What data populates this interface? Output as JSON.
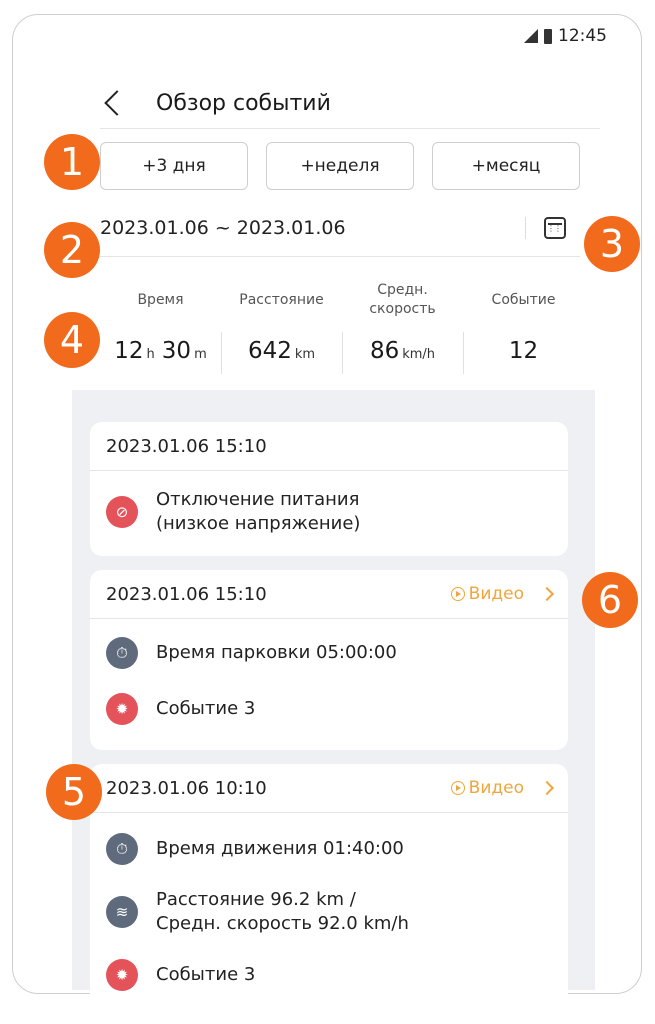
{
  "status": {
    "time": "12:45"
  },
  "header": {
    "title": "Обзор событий"
  },
  "range_buttons": [
    "+3 дня",
    "+неделя",
    "+месяц"
  ],
  "date_range": "2023.01.06 ~ 2023.01.06",
  "stats": {
    "time_label": "Время",
    "time_hours": "12",
    "time_hours_unit": "h",
    "time_minutes": "30",
    "time_minutes_unit": "m",
    "distance_label": "Расстояние",
    "distance_value": "642",
    "distance_unit": "km",
    "speed_label_1": "Средн.",
    "speed_label_2": "скорость",
    "speed_value": "86",
    "speed_unit": "km/h",
    "events_label": "Событие",
    "events_value": "12"
  },
  "cards": [
    {
      "time": "2023.01.06 15:10",
      "events": [
        {
          "icon": "power-off-icon",
          "line1": "Отключение питания",
          "line2": "(низкое напряжение)"
        }
      ]
    },
    {
      "time": "2023.01.06 15:10",
      "video_label": "Видео",
      "events": [
        {
          "icon": "stopwatch-icon",
          "line1": "Время парковки 05:00:00"
        },
        {
          "icon": "car-impact-icon",
          "line1": "Событие 3"
        }
      ]
    },
    {
      "time": "2023.01.06 10:10",
      "video_label": "Видео",
      "events": [
        {
          "icon": "stopwatch-icon",
          "line1": "Время движения 01:40:00"
        },
        {
          "icon": "route-icon",
          "line1": "Расстояние 96.2 km /",
          "line2": "Средн. скорость 92.0 km/h"
        },
        {
          "icon": "car-impact-icon",
          "line1": "Событие 3"
        }
      ]
    }
  ],
  "annotations": [
    "1",
    "2",
    "3",
    "4",
    "5",
    "6"
  ],
  "colors": {
    "accent_orange": "#f26b1c",
    "video_link": "#f0a63c",
    "event_red": "#e4525a",
    "event_grey": "#5f6b7d",
    "feed_bg": "#eef0f3"
  }
}
